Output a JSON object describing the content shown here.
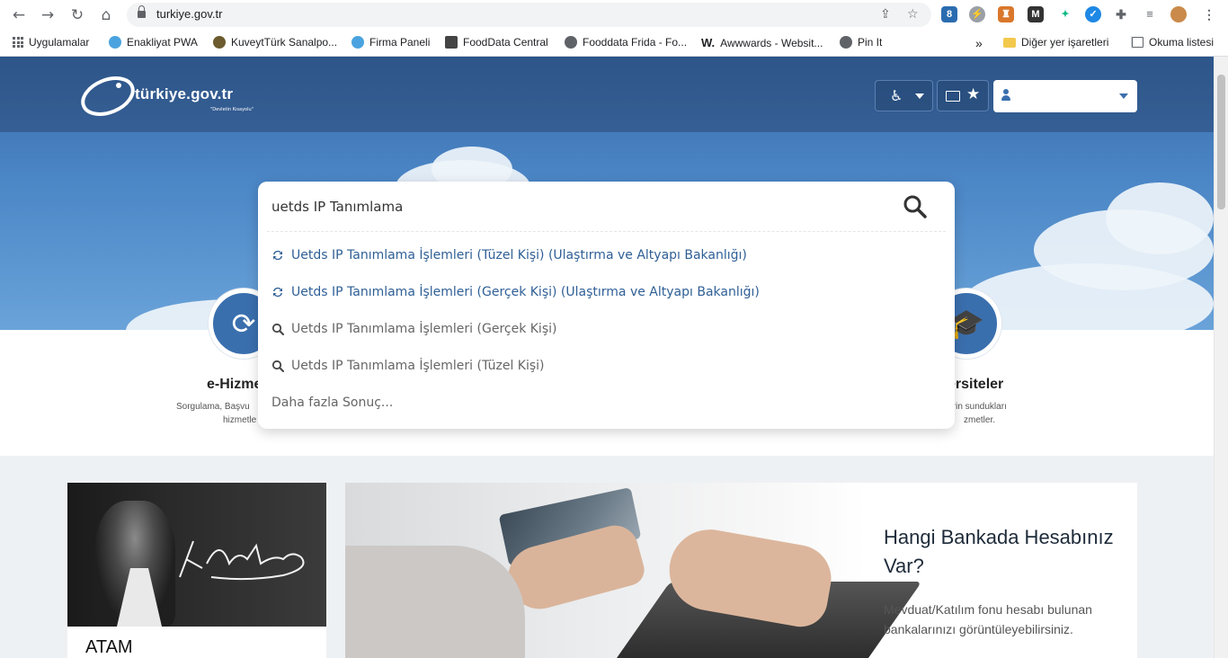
{
  "browser": {
    "url": "turkiye.gov.tr",
    "bookmarks": [
      {
        "label": "Uygulamalar"
      },
      {
        "label": "Enakliyat PWA"
      },
      {
        "label": "KuveytTürk Sanalpo..."
      },
      {
        "label": "Firma Paneli"
      },
      {
        "label": "FoodData Central"
      },
      {
        "label": "Fooddata Frida - Fo..."
      },
      {
        "label": "Awwwards - Websit..."
      },
      {
        "label": "Pin It"
      }
    ],
    "bookmarks_more": "»",
    "other_bookmarks": "Diğer yer işaretleri",
    "reading_list": "Okuma listesi"
  },
  "site": {
    "logo_text": "türkiye.gov.tr",
    "logo_sub": "\"Devletin Kısayolu\"",
    "accent": "#3a6fae"
  },
  "search": {
    "query": "uetds IP Tanımlama",
    "suggestions_services": [
      "Uetds IP Tanımlama İşlemleri (Tüzel Kişi) (Ulaştırma ve Altyapı Bakanlığı)",
      "Uetds IP Tanımlama İşlemleri (Gerçek Kişi) (Ulaştırma ve Altyapı Bakanlığı)"
    ],
    "suggestions_queries": [
      "Uetds IP Tanımlama İşlemleri (Gerçek Kişi)",
      "Uetds IP Tanımlama İşlemleri (Tüzel Kişi)"
    ],
    "more": "Daha fazla Sonuç..."
  },
  "services": {
    "left_title": "e-Hizme",
    "left_desc_1": "Sorgulama, Başvu",
    "left_desc_2": "hizmetle",
    "right_title": "ersiteler",
    "right_desc_1": "lerin sundukları",
    "right_desc_2": "zmetler."
  },
  "atam": {
    "title": "ATAM"
  },
  "bank": {
    "title": "Hangi Bankada Hesabınız Var?",
    "desc": "Mevduat/Katılım fonu hesabı bulunan bankalarınızı görüntüleyebilirsiniz."
  }
}
